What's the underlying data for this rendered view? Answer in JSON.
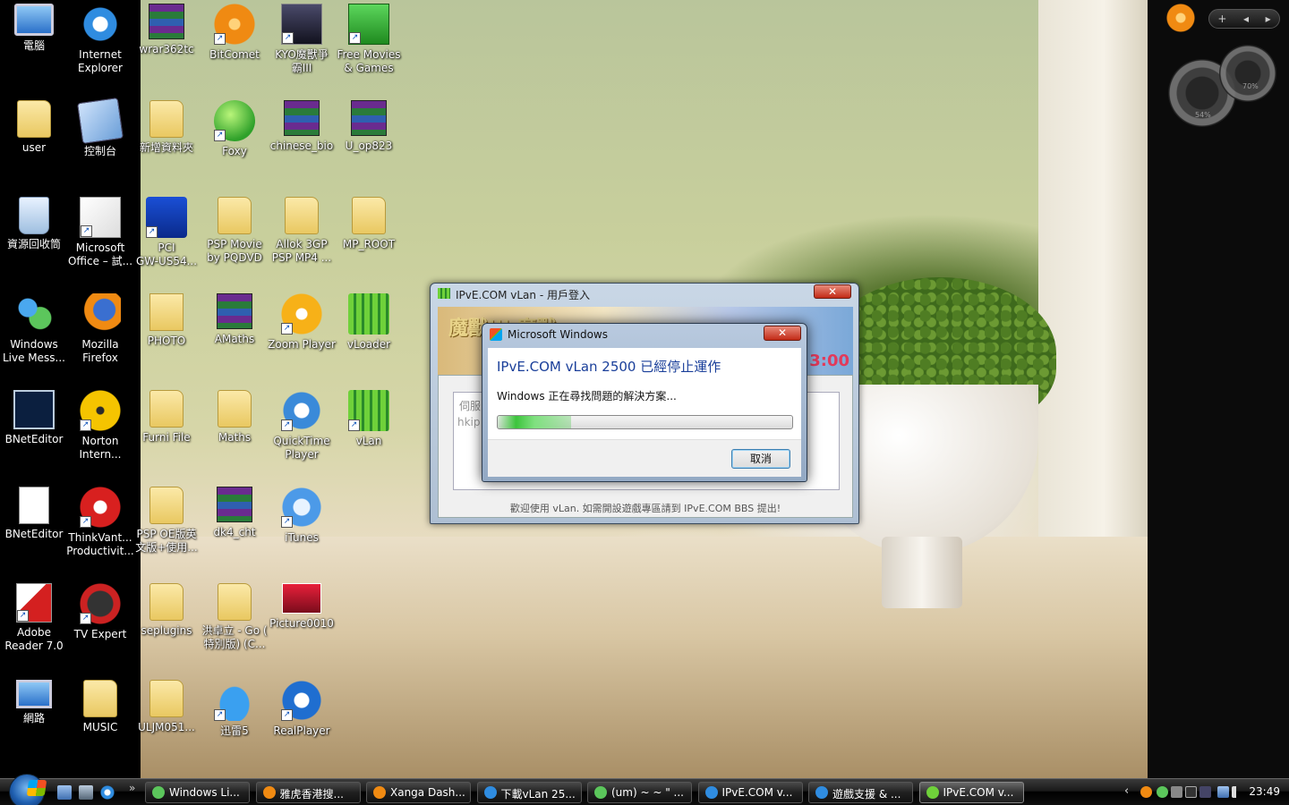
{
  "desktop": {
    "icons": [
      {
        "label": "電腦"
      },
      {
        "label": "Internet\nExplorer"
      },
      {
        "label": "wrar362tc"
      },
      {
        "label": "BitComet"
      },
      {
        "label": "KYO魔獸爭\n霸III"
      },
      {
        "label": "Free Movies\n& Games"
      },
      {
        "label": "user"
      },
      {
        "label": "控制台"
      },
      {
        "label": "新增資料夾"
      },
      {
        "label": "Foxy"
      },
      {
        "label": "chinese_bio"
      },
      {
        "label": "U_op823"
      },
      {
        "label": "資源回收筒"
      },
      {
        "label": "Microsoft\nOffice – 試..."
      },
      {
        "label": "PCI\nGW-US54..."
      },
      {
        "label": "PSP Movie\nby PQDVD"
      },
      {
        "label": "Allok 3GP\nPSP MP4 ..."
      },
      {
        "label": "MP_ROOT"
      },
      {
        "label": "Windows\nLive Mess..."
      },
      {
        "label": "Mozilla\nFirefox"
      },
      {
        "label": "PHOTO"
      },
      {
        "label": "AMaths"
      },
      {
        "label": "Zoom Player"
      },
      {
        "label": "vLoader"
      },
      {
        "label": "BNetEditor"
      },
      {
        "label": "Norton\nIntern..."
      },
      {
        "label": "Furni File"
      },
      {
        "label": "Maths"
      },
      {
        "label": "QuickTime\nPlayer"
      },
      {
        "label": "vLan"
      },
      {
        "label": "BNetEditor"
      },
      {
        "label": "ThinkVant...\nProductivit..."
      },
      {
        "label": "PSP OE版英\n文版+使用..."
      },
      {
        "label": "dk4_cht"
      },
      {
        "label": "iTunes"
      },
      {
        "label": "Adobe\nReader 7.0"
      },
      {
        "label": "TV Expert"
      },
      {
        "label": "seplugins"
      },
      {
        "label": "洪卓立 - Go (\n特別版) (C..."
      },
      {
        "label": "Picture0010"
      },
      {
        "label": "網路"
      },
      {
        "label": "MUSIC"
      },
      {
        "label": "ULJM051..."
      },
      {
        "label": "迅雷5"
      },
      {
        "label": "RealPlayer"
      }
    ]
  },
  "sidebar": {
    "controls": [
      "+",
      "◂",
      "▸"
    ],
    "cpu_meter": "54%",
    "mem_meter": "70%"
  },
  "vlan_window": {
    "title": "IPvE.COM vLan - 用戶登入",
    "close": "✕",
    "banner_text": "魔獸III 魔獸",
    "banner_time": "3:00",
    "server_label": "伺服",
    "server_value": "hkip",
    "footer": "歡迎使用 vLan. 如需開設遊戲專區請到 IPvE.COM BBS 提出!"
  },
  "error_dialog": {
    "title": "Microsoft Windows",
    "close": "✕",
    "heading": "IPvE.COM vLan 2500 已經停止運作",
    "message": "Windows 正在尋找問題的解決方案...",
    "progress": 0.25,
    "cancel": "取消"
  },
  "taskbar": {
    "more": "»",
    "tasks": [
      {
        "label": "Windows Li...",
        "color": "#5bc65b",
        "active": false
      },
      {
        "label": "雅虎香港搜...",
        "color": "#f08a12",
        "active": false
      },
      {
        "label": "Xanga Dash...",
        "color": "#f08a12",
        "active": false
      },
      {
        "label": "下載vLan 25...",
        "color": "#2f8ce0",
        "active": false
      },
      {
        "label": "(um) ~ ~ \" ...",
        "color": "#5bc65b",
        "active": false
      },
      {
        "label": "IPvE.COM v...",
        "color": "#2f8ce0",
        "active": false
      },
      {
        "label": "遊戲支援 & ...",
        "color": "#2f8ce0",
        "active": false
      },
      {
        "label": "IPvE.COM v...",
        "color": "#6fd13a",
        "active": true
      }
    ],
    "tray_chevron": "‹",
    "clock": "23:49"
  },
  "colors": {
    "accent": "#1a3f9a",
    "progress": "#3cc43c",
    "close_button": "#c22a16"
  }
}
